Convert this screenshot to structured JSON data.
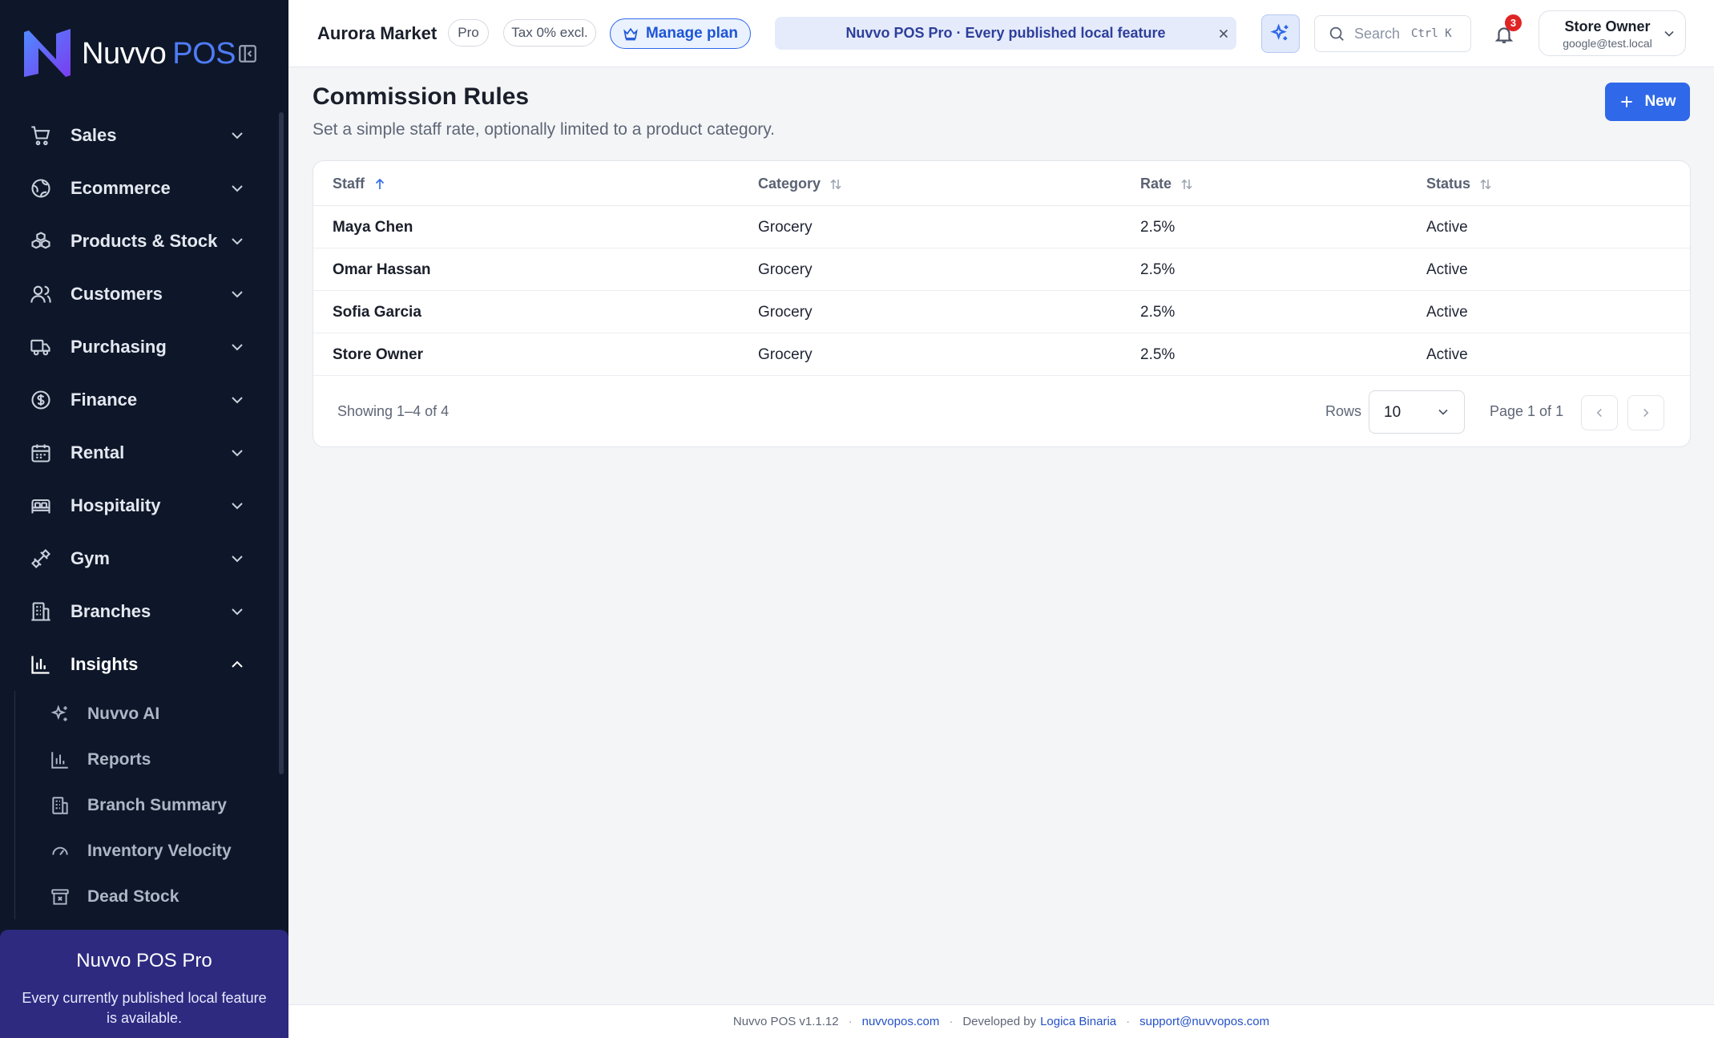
{
  "brand": {
    "name": "Nuvvo",
    "suffix": "POS"
  },
  "sidebar": {
    "items": [
      {
        "label": "Sales",
        "icon": "cart-icon"
      },
      {
        "label": "Ecommerce",
        "icon": "globe-icon"
      },
      {
        "label": "Products & Stock",
        "icon": "boxes-icon"
      },
      {
        "label": "Customers",
        "icon": "users-icon"
      },
      {
        "label": "Purchasing",
        "icon": "truck-icon"
      },
      {
        "label": "Finance",
        "icon": "dollar-circle-icon"
      },
      {
        "label": "Rental",
        "icon": "calendar-icon"
      },
      {
        "label": "Hospitality",
        "icon": "bed-icon"
      },
      {
        "label": "Gym",
        "icon": "dumbbell-icon"
      },
      {
        "label": "Branches",
        "icon": "building-icon"
      },
      {
        "label": "Insights",
        "icon": "bar-chart-icon",
        "expanded": true
      }
    ],
    "insights_sub": [
      {
        "label": "Nuvvo AI",
        "icon": "sparkles-icon"
      },
      {
        "label": "Reports",
        "icon": "bar-chart-icon"
      },
      {
        "label": "Branch Summary",
        "icon": "building-icon"
      },
      {
        "label": "Inventory Velocity",
        "icon": "gauge-icon"
      },
      {
        "label": "Dead Stock",
        "icon": "archive-x-icon"
      }
    ],
    "promo": {
      "title": "Nuvvo POS Pro",
      "text": "Every currently published local feature is available."
    }
  },
  "header": {
    "store_name": "Aurora Market",
    "plan_badge": "Pro",
    "tax_badge": "Tax 0% excl.",
    "manage_plan": "Manage plan",
    "banner": "Nuvvo POS Pro · Every published local feature",
    "search_label": "Search",
    "search_shortcut": "Ctrl K",
    "notifications_count": "3",
    "user_name": "Store Owner",
    "user_email": "google@test.local"
  },
  "page": {
    "title": "Commission Rules",
    "subtitle": "Set a simple staff rate, optionally limited to a product category.",
    "new_button": "New"
  },
  "table": {
    "columns": [
      {
        "label": "Staff",
        "sort": "asc"
      },
      {
        "label": "Category",
        "sort": "none"
      },
      {
        "label": "Rate",
        "sort": "none"
      },
      {
        "label": "Status",
        "sort": "none"
      }
    ],
    "rows": [
      {
        "staff": "Maya Chen",
        "category": "Grocery",
        "rate": "2.5%",
        "status": "Active"
      },
      {
        "staff": "Omar Hassan",
        "category": "Grocery",
        "rate": "2.5%",
        "status": "Active"
      },
      {
        "staff": "Sofia Garcia",
        "category": "Grocery",
        "rate": "2.5%",
        "status": "Active"
      },
      {
        "staff": "Store Owner",
        "category": "Grocery",
        "rate": "2.5%",
        "status": "Active"
      }
    ],
    "showing": "Showing 1–4 of 4",
    "rows_label": "Rows",
    "rows_value": "10",
    "page_label": "Page 1 of 1"
  },
  "footer": {
    "version": "Nuvvo POS v1.1.12",
    "website": "nuvvopos.com",
    "developed_by": "Developed by",
    "developer": "Logica Binaria",
    "email": "support@nuvvopos.com"
  },
  "colors": {
    "sidebar_bg": "#0e1729",
    "accent": "#2f68e8",
    "promo_bg": "#2d2a80",
    "badge_red": "#e02424"
  }
}
